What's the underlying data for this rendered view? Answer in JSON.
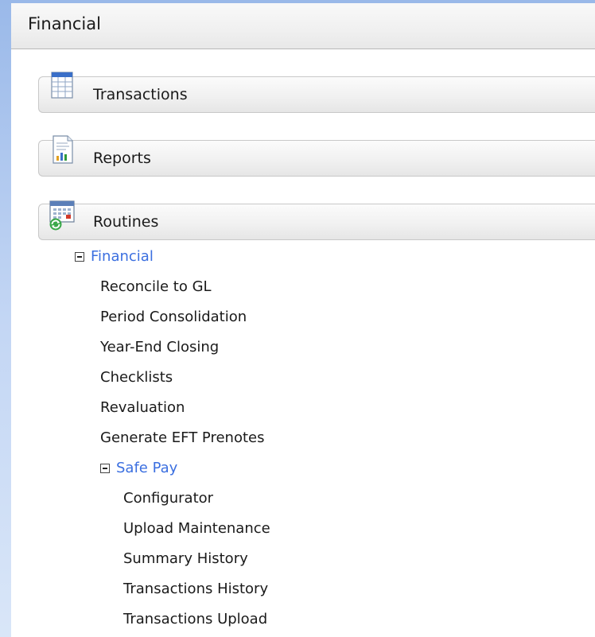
{
  "window": {
    "title": "Financial"
  },
  "sections": {
    "transactions": {
      "label": "Transactions",
      "icon": "transactions-grid-icon"
    },
    "reports": {
      "label": "Reports",
      "icon": "report-chart-icon"
    },
    "routines": {
      "label": "Routines",
      "icon": "routines-calendar-refresh-icon"
    }
  },
  "tree": {
    "financial": {
      "label": "Financial",
      "expanded": true,
      "items": [
        "Reconcile to GL",
        "Period Consolidation",
        "Year-End Closing",
        "Checklists",
        "Revaluation",
        "Generate EFT Prenotes"
      ],
      "safe_pay": {
        "label": "Safe Pay",
        "expanded": true,
        "items": [
          "Configurator",
          "Upload Maintenance",
          "Summary History",
          "Transactions History",
          "Transactions Upload"
        ]
      }
    }
  },
  "colors": {
    "link_blue": "#3b6fe0",
    "desktop_blue": "#9ab9e9"
  }
}
